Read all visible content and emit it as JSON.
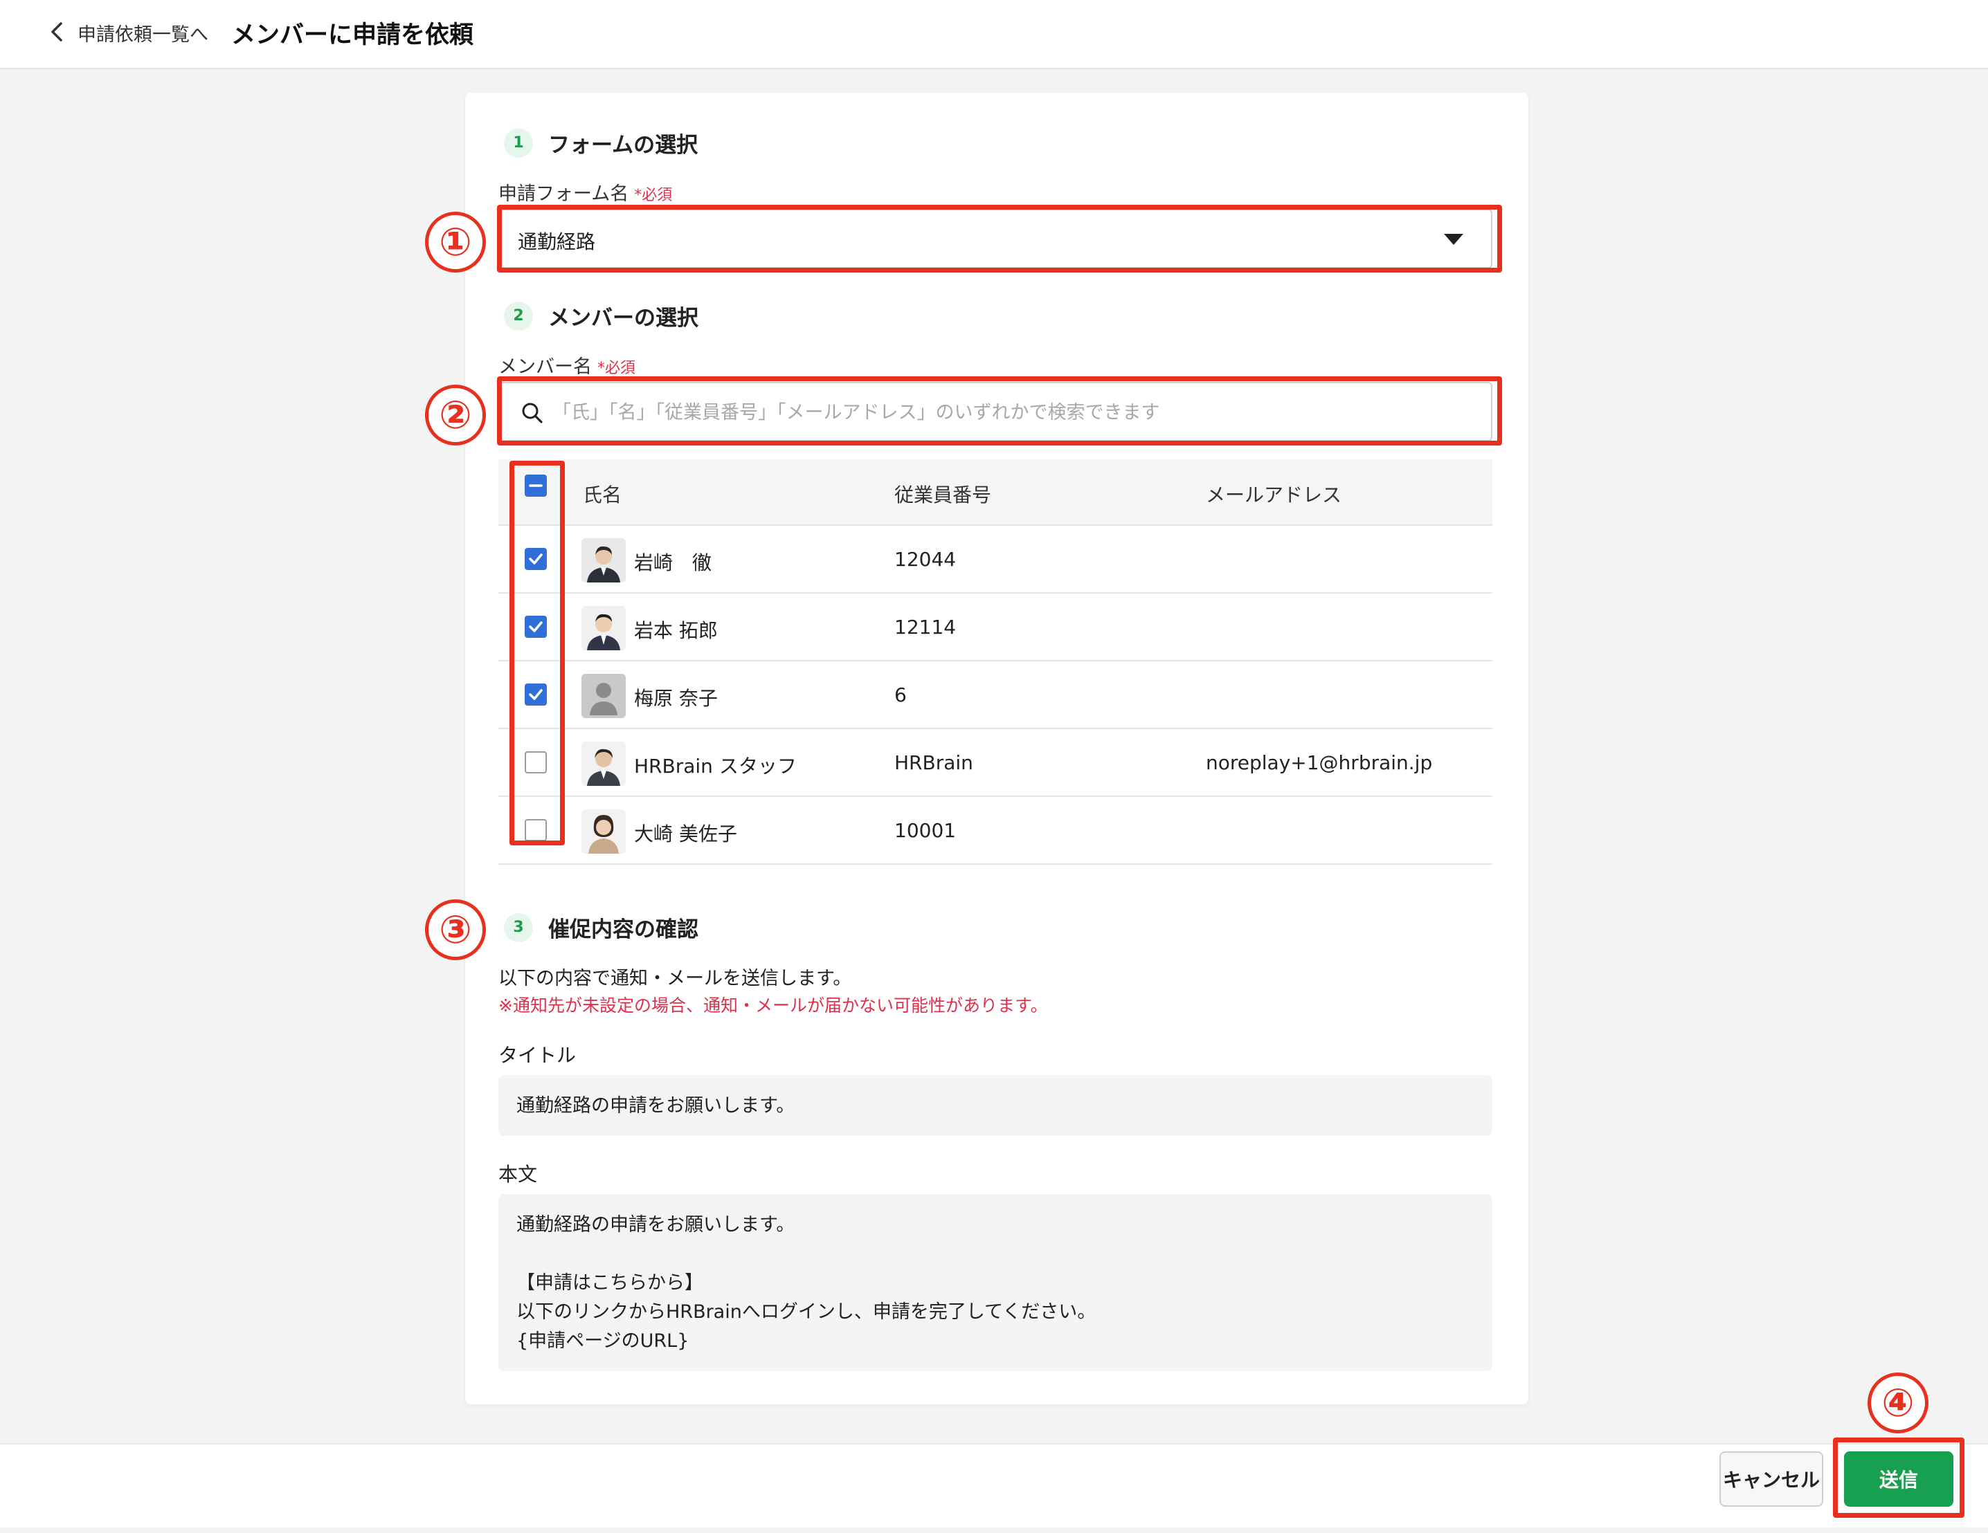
{
  "header": {
    "back_label": "申請依頼一覧へ",
    "title": "メンバーに申請を依頼"
  },
  "step1": {
    "number": "1",
    "title": "フォームの選択",
    "field_label": "申請フォーム名",
    "required": "*必須",
    "selected_value": "通勤経路"
  },
  "step2": {
    "number": "2",
    "title": "メンバーの選択",
    "field_label": "メンバー名",
    "required": "*必須",
    "search_placeholder": "「氏」「名」「従業員番号」「メールアドレス」のいずれかで検索できます",
    "columns": [
      "氏名",
      "従業員番号",
      "メールアドレス"
    ],
    "rows": [
      {
        "name": "岩崎　徹",
        "employee_no": "12044",
        "email": "",
        "checked": true
      },
      {
        "name": "岩本 拓郎",
        "employee_no": "12114",
        "email": "",
        "checked": true
      },
      {
        "name": "梅原 奈子",
        "employee_no": "6",
        "email": "",
        "checked": true
      },
      {
        "name": "HRBrain スタッフ",
        "employee_no": "HRBrain",
        "email": "noreplay+1@hrbrain.jp",
        "checked": false
      },
      {
        "name": "大崎 美佐子",
        "employee_no": "10001",
        "email": "",
        "checked": false
      }
    ]
  },
  "step3": {
    "number": "3",
    "title": "催促内容の確認",
    "description": "以下の内容で通知・メールを送信します。",
    "warning": "※通知先が未設定の場合、通知・メールが届かない可能性があります。",
    "title_label": "タイトル",
    "title_value": "通勤経路の申請をお願いします。",
    "body_label": "本文",
    "body_lines": [
      "通勤経路の申請をお願いします。",
      "",
      "【申請はこちらから】",
      "以下のリンクからHRBrainへログインし、申請を完了してください。",
      "{申請ページのURL}"
    ]
  },
  "annotations": [
    "①",
    "②",
    "③",
    "④"
  ],
  "footer": {
    "cancel_label": "キャンセル",
    "send_label": "送信"
  },
  "colors": {
    "accent_green": "#17a04f",
    "annotation_red": "#e8301e",
    "checkbox_blue": "#2f6fd6",
    "required_red": "#e0304c"
  }
}
